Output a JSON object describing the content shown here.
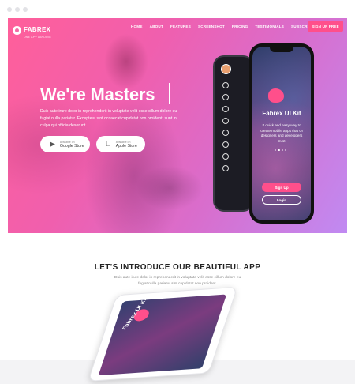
{
  "brand": {
    "name": "FABREX",
    "tagline": "ONE APP LANDING"
  },
  "nav": {
    "items": [
      "HOME",
      "ABOUT",
      "FEATURES",
      "SCREENSHOT",
      "PRICING",
      "TESTIMONIALS",
      "SUBSCRIBE"
    ],
    "cta": "SIGN UP FREE"
  },
  "hero": {
    "title": "We're Masters",
    "description": "Duis aute irure dolor in reprehenderit in voluptate velit esse cillum dolore eu fugiat nulla pariatur. Excepteur sint occaecat cupidatat non proident, sunt in culpa qui officia deserunt.",
    "google": {
      "small": "available on",
      "big": "Google Store"
    },
    "apple": {
      "small": "available on",
      "big": "Apple Store"
    }
  },
  "phone": {
    "title": "Fabrex UI Kit",
    "description": "It quick and easy way to create mobile apps that UI designers and developers trust",
    "signup": "Sign Up",
    "login": "Login"
  },
  "intro": {
    "title": "LET'S INTRODUCE OUR BEAUTIFUL APP",
    "description": "Duis aute irure dolor in reprehenderit in voluptate velit esse cillum dolore eu fugiat nulla pariatur sint cupidatat non proident."
  },
  "tablet": {
    "title": "Fabrex UI Kit"
  },
  "colors": {
    "accent": "#ff4f8b",
    "gradient_start": "#ff5f9a",
    "gradient_end": "#c08af2"
  },
  "icons": {
    "google": "play-icon",
    "apple": "apple-icon"
  }
}
